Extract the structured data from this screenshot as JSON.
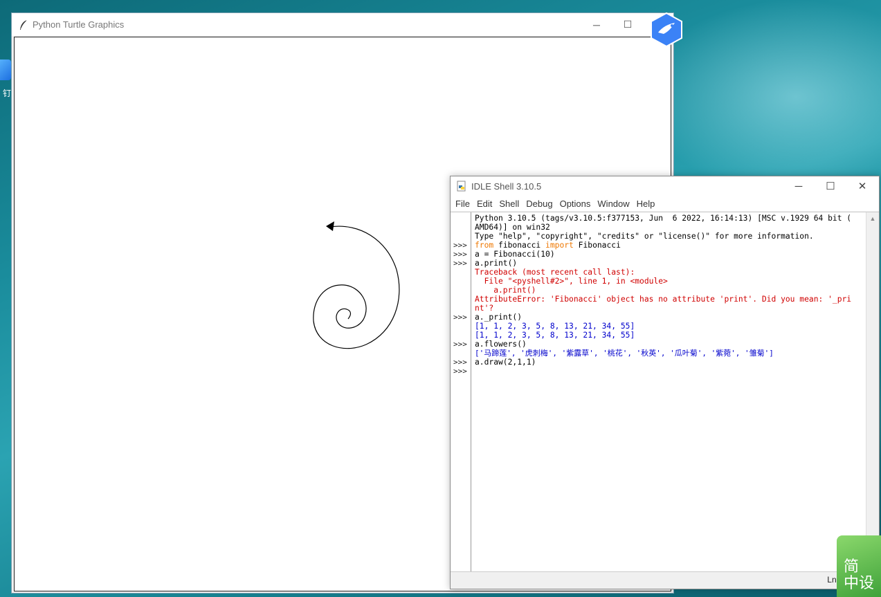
{
  "desktop": {
    "icon_label": "钉"
  },
  "turtle_window": {
    "title": "Python Turtle Graphics",
    "minimize_glyph": "─",
    "maximize_glyph": "☐"
  },
  "idle_window": {
    "title": "IDLE Shell 3.10.5",
    "minimize_glyph": "─",
    "maximize_glyph": "☐",
    "close_glyph": "✕",
    "menu": [
      "File",
      "Edit",
      "Shell",
      "Debug",
      "Options",
      "Window",
      "Help"
    ],
    "prompts": [
      ">>>",
      ">>>",
      ">>>",
      ">>>",
      ">>>",
      ">>>",
      ">>>"
    ],
    "lines": [
      {
        "text": "Python 3.10.5 (tags/v3.10.5:f377153, Jun  6 2022, 16:14:13) [MSC v.1929 64 bit (",
        "style": "plain"
      },
      {
        "text": "AMD64)] on win32",
        "style": "plain"
      },
      {
        "text": "Type \"help\", \"copyright\", \"credits\" or \"license()\" for more information.",
        "style": "plain"
      },
      {
        "kw1": "from",
        "mid": " fibonacci ",
        "kw2": "import",
        "rest": " Fibonacci",
        "style": "import"
      },
      {
        "text": "a = Fibonacci(10)",
        "style": "plain"
      },
      {
        "text": "a.print()",
        "style": "plain"
      },
      {
        "text": "Traceback (most recent call last):",
        "style": "err"
      },
      {
        "text": "  File \"<pyshell#2>\", line 1, in <module>",
        "style": "err"
      },
      {
        "text": "    a.print()",
        "style": "err"
      },
      {
        "text": "AttributeError: 'Fibonacci' object has no attribute 'print'. Did you mean: '_pri",
        "style": "err"
      },
      {
        "text": "nt'?",
        "style": "err"
      },
      {
        "text": "a._print()",
        "style": "plain"
      },
      {
        "text": "[1, 1, 2, 3, 5, 8, 13, 21, 34, 55]",
        "style": "out"
      },
      {
        "text": "[1, 1, 2, 3, 5, 8, 13, 21, 34, 55]",
        "style": "out"
      },
      {
        "text": "a.flowers()",
        "style": "plain"
      },
      {
        "text": "['马蹄莲', '虎刺梅', '紫露草', '桃花', '秋英', '瓜叶菊', '紫菀', '雏菊']",
        "style": "out"
      },
      {
        "text": "a.draw(2,1,1)",
        "style": "plain"
      }
    ],
    "status": "Ln: 1"
  },
  "corner_badge": {
    "line1": "简",
    "line2": "中设"
  }
}
